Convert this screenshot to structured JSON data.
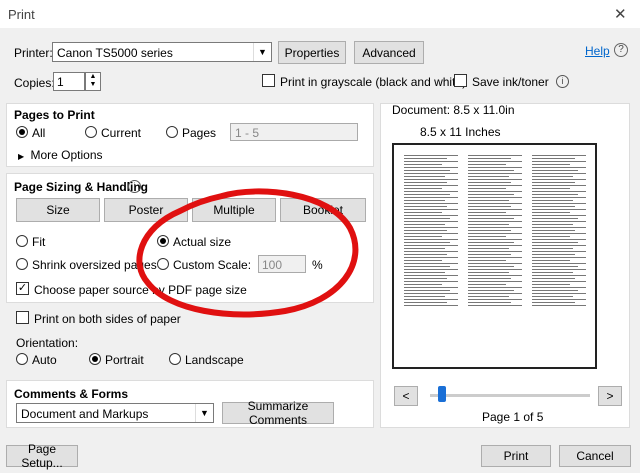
{
  "window": {
    "title": "Print",
    "close": "✕"
  },
  "printer": {
    "label": "Printer:",
    "value": "Canon TS5000 series",
    "properties": "Properties",
    "advanced": "Advanced",
    "help": "Help"
  },
  "copies": {
    "label": "Copies:",
    "value": "1",
    "grayscale": "Print in grayscale (black and white)",
    "save_ink": "Save ink/toner"
  },
  "pages": {
    "title": "Pages to Print",
    "all": "All",
    "current": "Current",
    "pages": "Pages",
    "range_placeholder": "1 - 5",
    "more": "More Options"
  },
  "sizing": {
    "title": "Page Sizing & Handling",
    "size": "Size",
    "poster": "Poster",
    "multiple": "Multiple",
    "booklet": "Booklet",
    "fit": "Fit",
    "actual": "Actual size",
    "shrink": "Shrink oversized pages",
    "custom": "Custom Scale:",
    "scale_value": "100",
    "percent": "%",
    "choose_source": "Choose paper source by PDF page size"
  },
  "duplex": {
    "label": "Print on both sides of paper"
  },
  "orientation": {
    "label": "Orientation:",
    "auto": "Auto",
    "portrait": "Portrait",
    "landscape": "Landscape"
  },
  "comments": {
    "title": "Comments & Forms",
    "value": "Document and Markups",
    "summarize": "Summarize Comments"
  },
  "preview": {
    "document": "Document: 8.5 x 11.0in",
    "paper": "8.5 x 11 Inches",
    "prev": "<",
    "next": ">",
    "page_of": "Page 1 of 5",
    "slider_position": 0.05
  },
  "footer": {
    "page_setup": "Page Setup...",
    "print": "Print",
    "cancel": "Cancel"
  },
  "colors": {
    "annotation": "#e01010",
    "link": "#0066cc"
  }
}
